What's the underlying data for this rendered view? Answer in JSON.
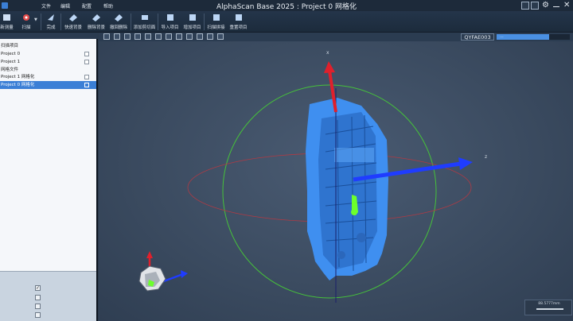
{
  "titlebar": {
    "title": "AlphaScan Base 2025 : Project 0 网格化",
    "menus": [
      "文件",
      "编辑",
      "配置",
      "帮助"
    ]
  },
  "toolbar": {
    "buttons": [
      "新测量",
      "扫描",
      "完成",
      "快速背景",
      "删除背景",
      "撤回删除",
      "添加剪切面",
      "导入项目",
      "增加项目",
      "扫描拼接",
      "重置项目"
    ]
  },
  "tree": {
    "rows": [
      "扫描项目",
      "Project 0",
      "Project 1",
      "网格文件",
      "Project 1 网格化",
      "Project 0 网格化"
    ],
    "selected_index": 5
  },
  "left_bottom": {
    "checks": [
      true,
      false,
      false,
      false
    ]
  },
  "viewport": {
    "device": "QYFAE003",
    "progress_label": "...",
    "progress_value": 0.72,
    "axis_x_label": "x",
    "axis_z_label": "z",
    "scale_text": "88.5777mm"
  },
  "colors": {
    "accent": "#3b7fd6",
    "mesh": "#3f8ff0",
    "axis_red": "#e0202c",
    "axis_blue": "#1f3cff",
    "axis_green": "#6cff2c"
  }
}
